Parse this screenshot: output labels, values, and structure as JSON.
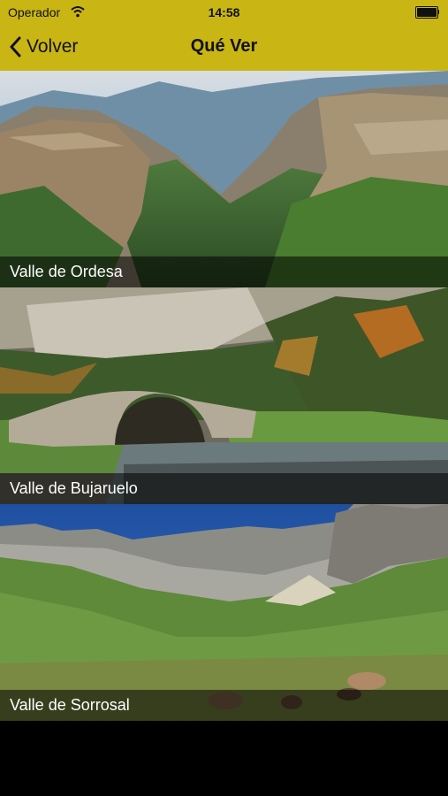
{
  "status_bar": {
    "carrier": "Operador",
    "time": "14:58",
    "wifi_icon": "wifi-icon",
    "battery_icon": "battery-icon"
  },
  "nav": {
    "back_label": "Volver",
    "back_icon": "chevron-left-icon",
    "title": "Qué Ver"
  },
  "colors": {
    "header_background": "#c9b514",
    "caption_overlay": "rgba(0,0,0,0.55)",
    "page_background": "#000000"
  },
  "places": [
    {
      "label": "Valle de Ordesa"
    },
    {
      "label": "Valle de Bujaruelo"
    },
    {
      "label": "Valle de Sorrosal"
    }
  ]
}
